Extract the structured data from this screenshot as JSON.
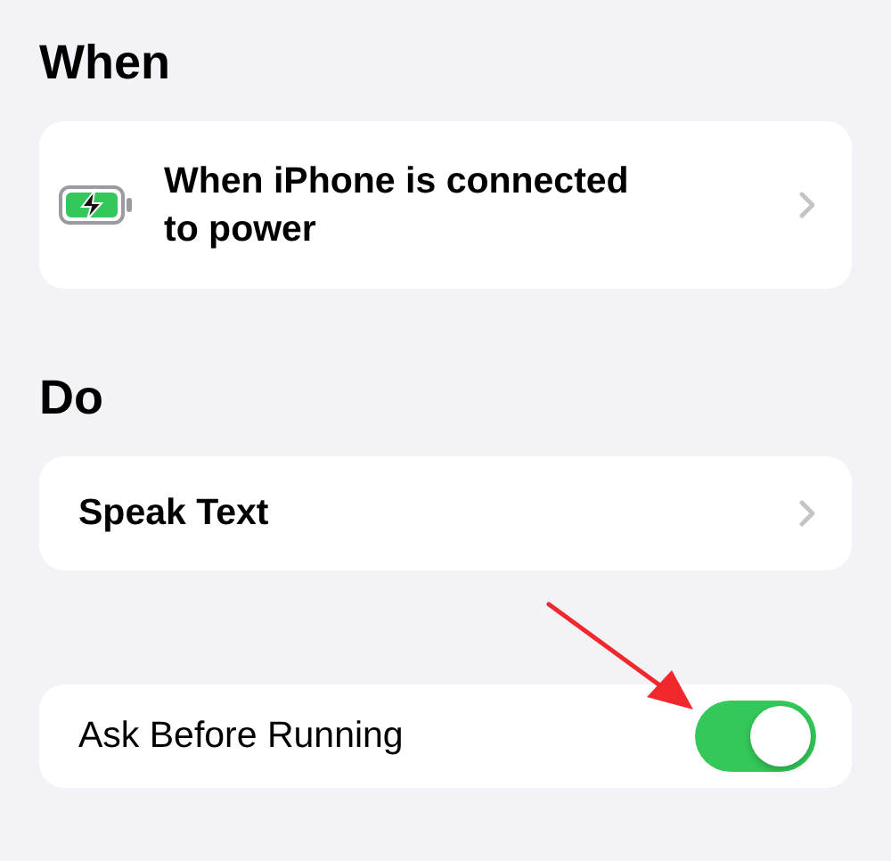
{
  "sections": [
    {
      "heading": "When",
      "items": [
        {
          "kind": "trigger",
          "label": "When iPhone is connected to power"
        }
      ]
    },
    {
      "heading": "Do",
      "items": [
        {
          "kind": "action",
          "label": "Speak Text"
        }
      ]
    },
    {
      "items": [
        {
          "kind": "toggle",
          "label": "Ask Before Running",
          "on": true
        }
      ]
    }
  ]
}
